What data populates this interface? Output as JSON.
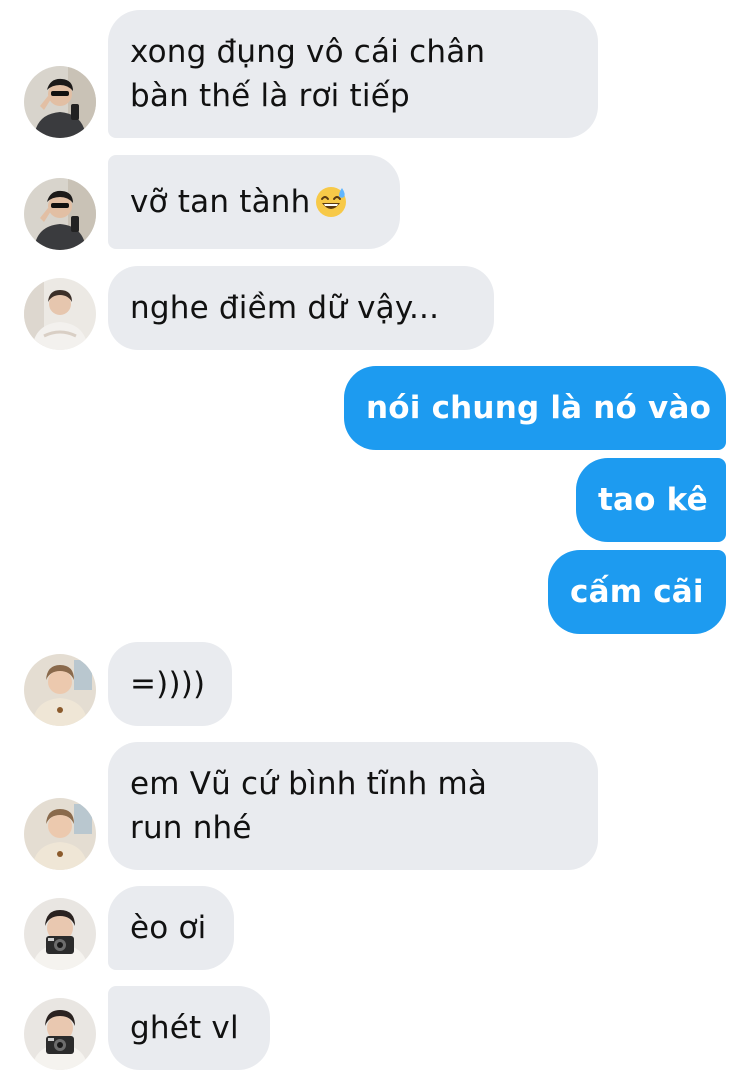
{
  "messages": [
    {
      "text": "xong đụng vô cái chân",
      "text2": "bàn thế là rơi tiếp"
    },
    {
      "text": "vỡ tan tành",
      "emoji": "grinning-sweat-emoji"
    },
    {
      "text": "nghe điềm dữ vậy..."
    },
    {
      "text": "nói chung là nó vào"
    },
    {
      "text": "tao kê"
    },
    {
      "text": "cấm cãi"
    },
    {
      "text": "=))))"
    },
    {
      "text": "em Vũ cứ bình tĩnh mà",
      "text2": "run nhé"
    },
    {
      "text": "èo ơi"
    },
    {
      "text": "ghét vl"
    }
  ],
  "colors": {
    "incoming_bubble": "#e9ebef",
    "outgoing_bubble": "#1d9bf0",
    "incoming_text": "#111111",
    "outgoing_text": "#ffffff"
  }
}
